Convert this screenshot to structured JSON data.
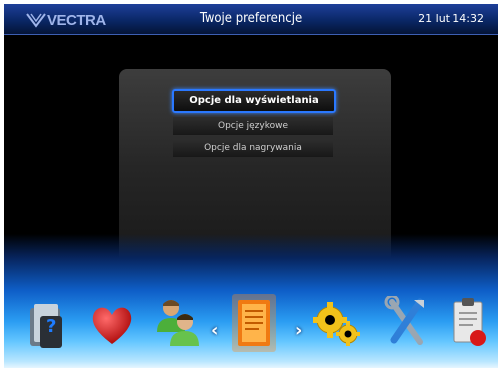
{
  "header": {
    "logo_text": "VECTRA",
    "title": "Twoje preferencje",
    "date": "21 lut",
    "time": "14:32"
  },
  "menu": {
    "items": [
      {
        "label": "Opcje dla wyświetlania",
        "selected": true
      },
      {
        "label": "Opcje językowe",
        "selected": false
      },
      {
        "label": "Opcje dla nagrywania",
        "selected": false
      }
    ]
  },
  "dock": {
    "icons": [
      "help-folder-icon",
      "heart-icon",
      "users-icon",
      "document-icon",
      "gears-icon",
      "tools-icon",
      "clipboard-record-icon"
    ],
    "nav_left": "‹",
    "nav_right": "›"
  },
  "colors": {
    "accent": "#2a78ff",
    "header_bg": "#0a2766"
  }
}
